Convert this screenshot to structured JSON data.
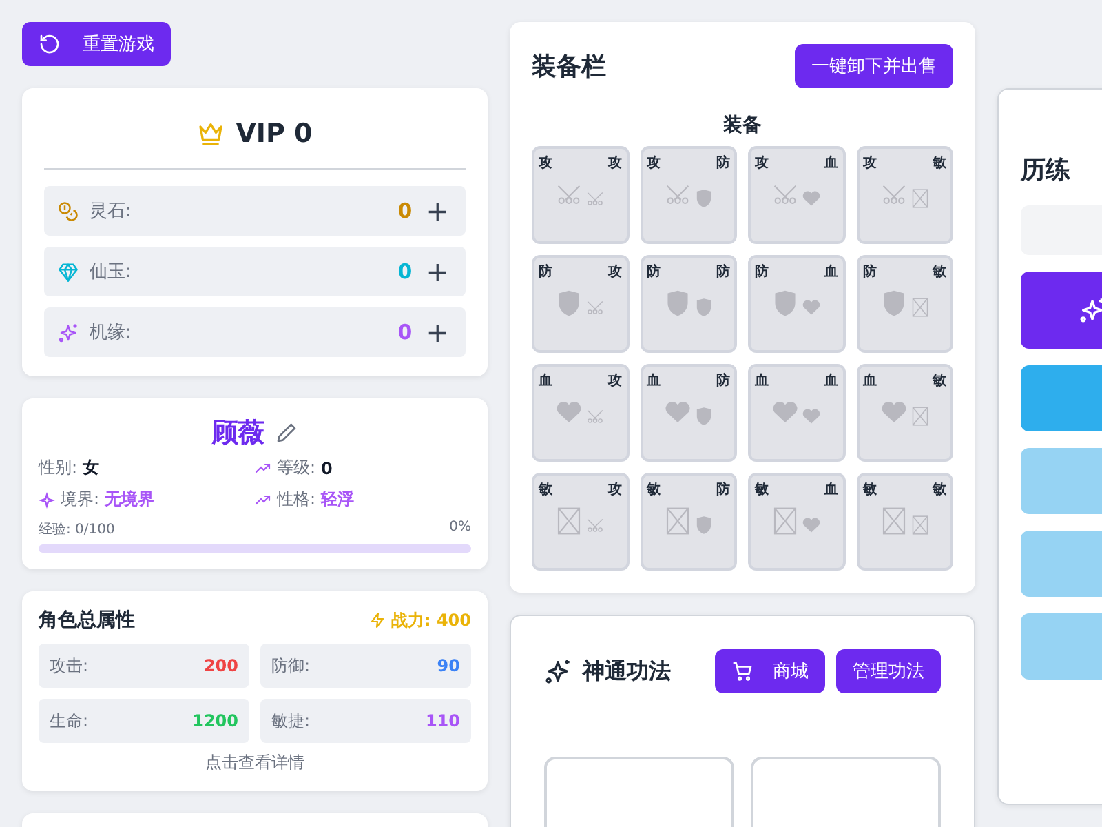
{
  "reset_button": {
    "label": "重置游戏"
  },
  "vip": {
    "title": "VIP 0",
    "currencies": [
      {
        "kind": "coins",
        "label": "灵石:",
        "value": "0",
        "color": "#ca8a04",
        "add": "+"
      },
      {
        "kind": "gem",
        "label": "仙玉:",
        "value": "0",
        "color": "#06b6d4",
        "add": "+"
      },
      {
        "kind": "sparkle",
        "label": "机缘:",
        "value": "0",
        "color": "#a855f7",
        "add": "+"
      }
    ]
  },
  "character": {
    "name": "顾薇",
    "stats": [
      {
        "kind": "plain",
        "label": "性别:",
        "value": "女",
        "highlight": false
      },
      {
        "kind": "trend",
        "label": "等级:",
        "value": "0",
        "highlight": false
      },
      {
        "kind": "sparkle",
        "label": "境界:",
        "value": "无境界",
        "highlight": true
      },
      {
        "kind": "trend",
        "label": "性格:",
        "value": "轻浮",
        "highlight": true
      }
    ],
    "exp": {
      "label": "经验: 0/100",
      "percent": "0%",
      "level": 0
    }
  },
  "attributes": {
    "title": "角色总属性",
    "power": "战力: 400",
    "stats": [
      {
        "label": "攻击:",
        "value": "200",
        "color": "#ef4444"
      },
      {
        "label": "防御:",
        "value": "90",
        "color": "#3b82f6"
      },
      {
        "label": "生命:",
        "value": "1200",
        "color": "#22c55e"
      },
      {
        "label": "敏捷:",
        "value": "110",
        "color": "#a855f7"
      }
    ],
    "footer": "点击查看详情"
  },
  "equipment": {
    "title": "装备栏",
    "button": "一键卸下并出售",
    "subtitle": "装备",
    "slots": [
      {
        "main": {
          "label": "攻",
          "kind": "attack"
        },
        "sub": {
          "label": "攻",
          "kind": "attack"
        }
      },
      {
        "main": {
          "label": "攻",
          "kind": "attack"
        },
        "sub": {
          "label": "防",
          "kind": "defense"
        }
      },
      {
        "main": {
          "label": "攻",
          "kind": "attack"
        },
        "sub": {
          "label": "血",
          "kind": "health"
        }
      },
      {
        "main": {
          "label": "攻",
          "kind": "attack"
        },
        "sub": {
          "label": "敏",
          "kind": "agility"
        }
      },
      {
        "main": {
          "label": "防",
          "kind": "defense"
        },
        "sub": {
          "label": "攻",
          "kind": "attack"
        }
      },
      {
        "main": {
          "label": "防",
          "kind": "defense"
        },
        "sub": {
          "label": "防",
          "kind": "defense"
        }
      },
      {
        "main": {
          "label": "防",
          "kind": "defense"
        },
        "sub": {
          "label": "血",
          "kind": "health"
        }
      },
      {
        "main": {
          "label": "防",
          "kind": "defense"
        },
        "sub": {
          "label": "敏",
          "kind": "agility"
        }
      },
      {
        "main": {
          "label": "血",
          "kind": "health"
        },
        "sub": {
          "label": "攻",
          "kind": "attack"
        }
      },
      {
        "main": {
          "label": "血",
          "kind": "health"
        },
        "sub": {
          "label": "防",
          "kind": "defense"
        }
      },
      {
        "main": {
          "label": "血",
          "kind": "health"
        },
        "sub": {
          "label": "血",
          "kind": "health"
        }
      },
      {
        "main": {
          "label": "血",
          "kind": "health"
        },
        "sub": {
          "label": "敏",
          "kind": "agility"
        }
      },
      {
        "main": {
          "label": "敏",
          "kind": "agility"
        },
        "sub": {
          "label": "攻",
          "kind": "attack"
        }
      },
      {
        "main": {
          "label": "敏",
          "kind": "agility"
        },
        "sub": {
          "label": "防",
          "kind": "defense"
        }
      },
      {
        "main": {
          "label": "敏",
          "kind": "agility"
        },
        "sub": {
          "label": "血",
          "kind": "health"
        }
      },
      {
        "main": {
          "label": "敏",
          "kind": "agility"
        },
        "sub": {
          "label": "敏",
          "kind": "agility"
        }
      }
    ]
  },
  "skills": {
    "title": "神通功法",
    "shop_button": "商城",
    "manage_button": "管理功法"
  },
  "training": {
    "title": "历练",
    "bars": [
      {
        "kind": "field"
      },
      {
        "kind": "primary"
      },
      {
        "kind": "info"
      },
      {
        "kind": "muted"
      },
      {
        "kind": "muted"
      },
      {
        "kind": "muted"
      }
    ]
  }
}
